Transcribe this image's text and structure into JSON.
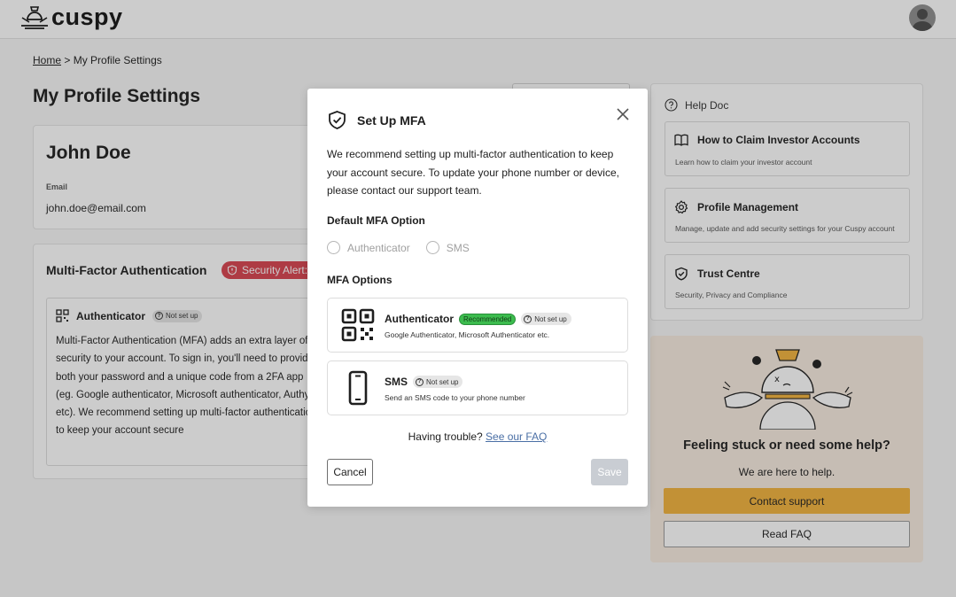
{
  "header": {
    "logo_text": "cuspy",
    "logo_icon": "bell-mascot-icon",
    "avatar_icon": "user-avatar-icon"
  },
  "breadcrumb": {
    "home": "Home",
    "separator": ">",
    "current": "My Profile Settings"
  },
  "page": {
    "title": "My Profile Settings"
  },
  "profile": {
    "name": "John Doe",
    "email_label": "Email",
    "email": "john.doe@email.com"
  },
  "mfa_section": {
    "title": "Multi-Factor Authentication",
    "alert": "Security Alert:",
    "alert_color": "#d9434f",
    "authenticator_title": "Authenticator",
    "status": "Not set up",
    "description": "Multi-Factor Authentication (MFA) adds an extra layer of security to your account. To sign in, you'll need to provide both your password and a unique code from a 2FA app (eg. Google authenticator, Microsoft authenticator, Authy etc). We recommend setting up multi-factor authentication to keep your account secure"
  },
  "help": {
    "title": "Help Doc",
    "items": [
      {
        "title": "How to Claim Investor Accounts",
        "desc": "Learn how to claim your investor account",
        "icon": "book-icon"
      },
      {
        "title": "Profile Management",
        "desc": "Manage, update and add security settings for your Cuspy account",
        "icon": "gear-icon"
      },
      {
        "title": "Trust Centre",
        "desc": "Security, Privacy and Compliance",
        "icon": "shield-check-icon"
      }
    ]
  },
  "support": {
    "title": "Feeling stuck or need some help?",
    "subtitle": "We are here to help.",
    "contact_label": "Contact support",
    "faq_label": "Read FAQ",
    "accent_color": "#f2b33d"
  },
  "modal": {
    "title": "Set Up MFA",
    "description": "We recommend setting up multi-factor authentication to keep your account secure. To update your phone number or device, please contact our support team.",
    "default_label": "Default MFA Option",
    "radio_options": [
      "Authenticator",
      "SMS"
    ],
    "options_label": "MFA Options",
    "options": [
      {
        "title": "Authenticator",
        "badge": "Recommended",
        "status": "Not set up",
        "desc": "Google Authenticator, Microsoft Authenticator etc.",
        "icon": "qr-code-icon"
      },
      {
        "title": "SMS",
        "status": "Not set up",
        "desc": "Send an SMS code to your phone number",
        "icon": "smartphone-icon"
      }
    ],
    "trouble_text": "Having trouble?",
    "faq_link": "See our FAQ",
    "cancel_label": "Cancel",
    "save_label": "Save",
    "badge_green": "#3cbc4e"
  }
}
